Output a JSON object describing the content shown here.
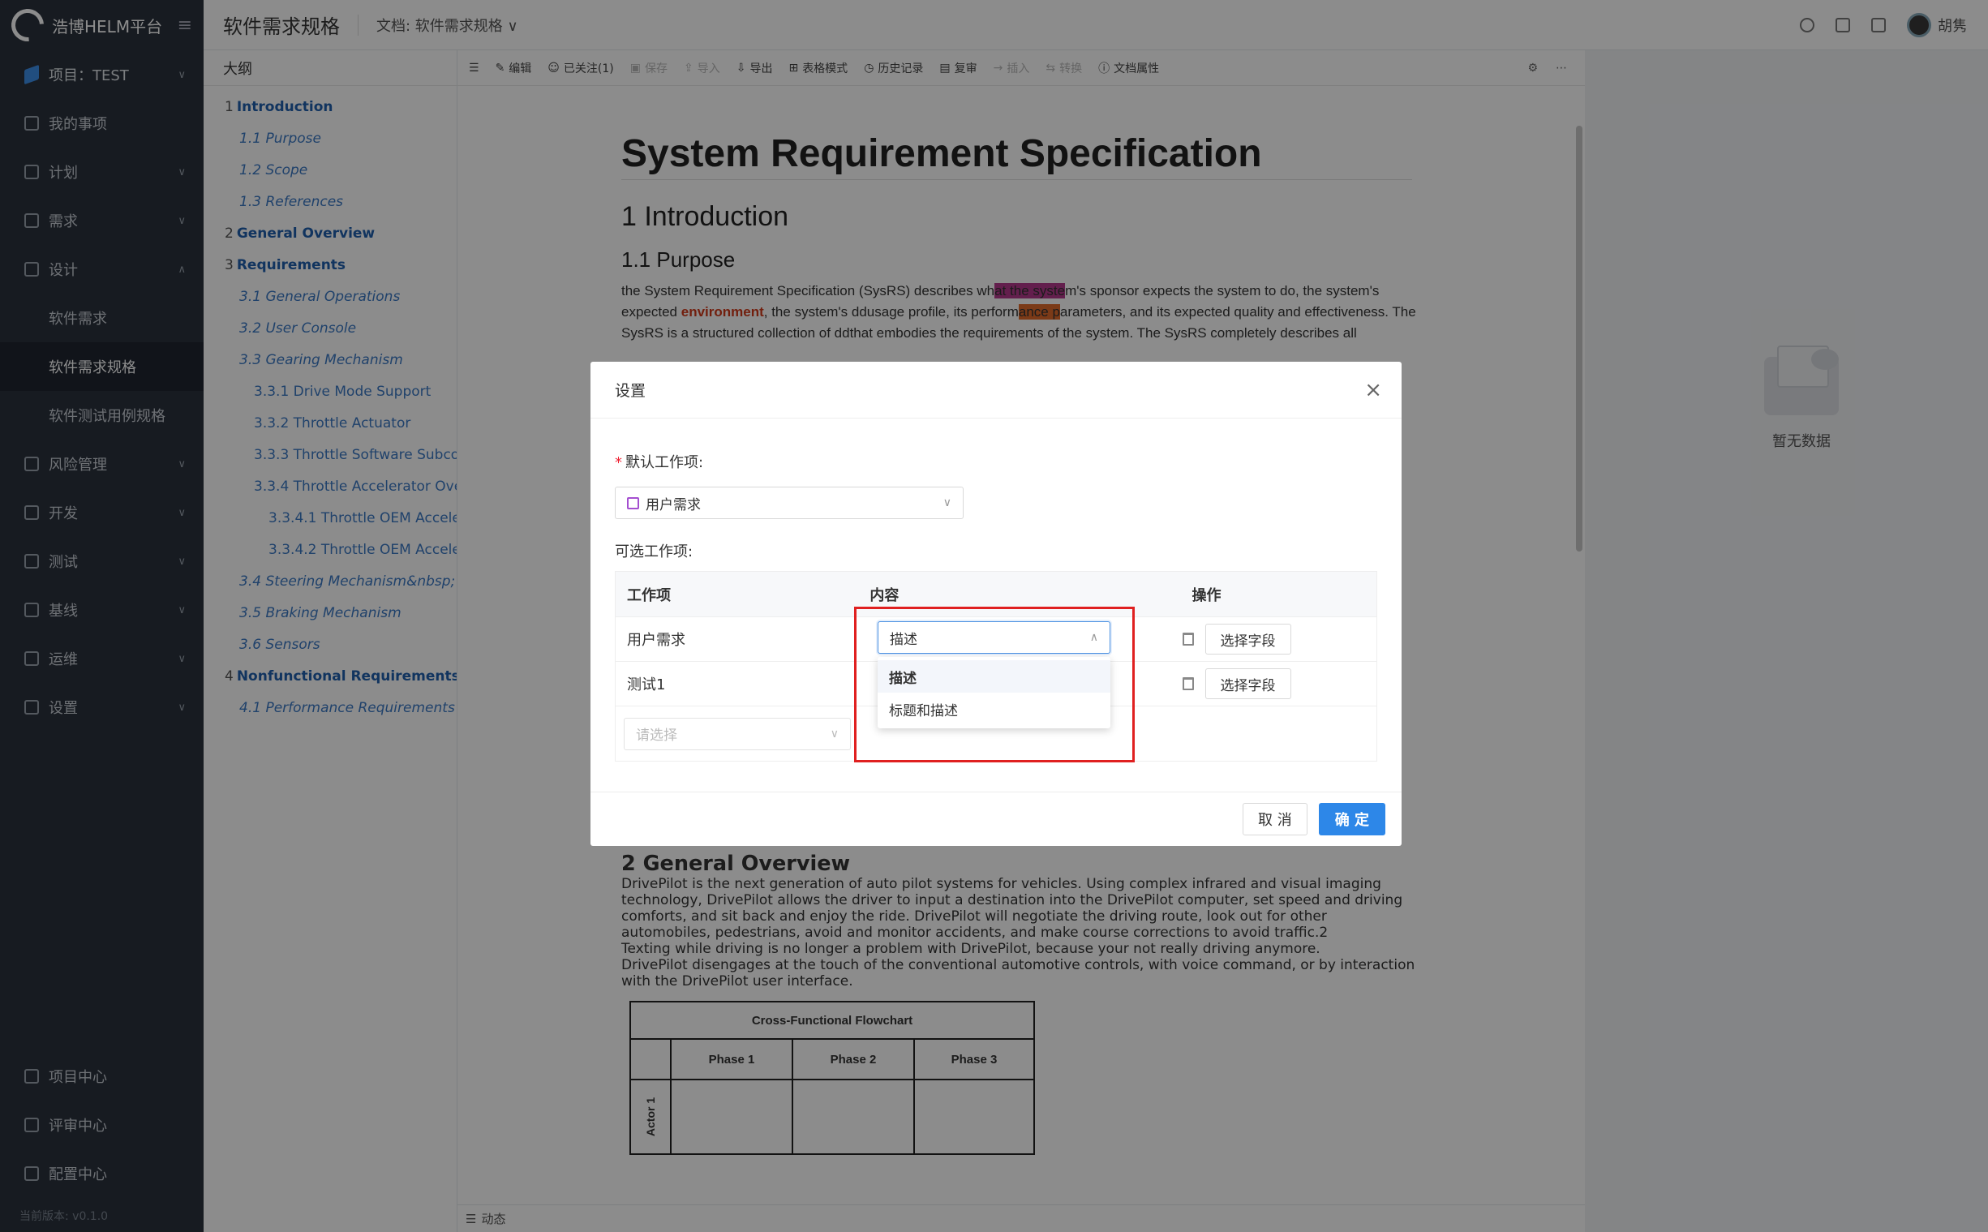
{
  "app": {
    "logo_text": "浩博HELM平台",
    "version": "当前版本: v0.1.0"
  },
  "sidebar": {
    "project": "项目：TEST",
    "items": [
      {
        "label": "我的事项",
        "chevron": false
      },
      {
        "label": "计划",
        "chevron": true
      },
      {
        "label": "需求",
        "chevron": true
      },
      {
        "label": "设计",
        "chevron": true,
        "expanded": true
      },
      {
        "label": "软件需求",
        "sub": true
      },
      {
        "label": "软件需求规格",
        "sub": true,
        "active": true
      },
      {
        "label": "软件测试用例规格",
        "sub": true
      },
      {
        "label": "风险管理",
        "chevron": true
      },
      {
        "label": "开发",
        "chevron": true
      },
      {
        "label": "测试",
        "chevron": true
      },
      {
        "label": "基线",
        "chevron": true
      },
      {
        "label": "运维",
        "chevron": true
      },
      {
        "label": "设置",
        "chevron": true
      }
    ],
    "bottom_items": [
      "项目中心",
      "评审中心",
      "配置中心"
    ]
  },
  "topbar": {
    "title": "软件需求规格",
    "doc_label": "文档: 软件需求规格",
    "user": "胡隽"
  },
  "outline": {
    "header": "大纲",
    "items": [
      {
        "num": "1",
        "text": "Introduction",
        "level": 1
      },
      {
        "text": "1.1 Purpose",
        "level": 2
      },
      {
        "text": "1.2 Scope",
        "level": 2
      },
      {
        "text": "1.3 References",
        "level": 2
      },
      {
        "num": "2",
        "text": "General Overview",
        "level": 1
      },
      {
        "num": "3",
        "text": "Requirements",
        "level": 1
      },
      {
        "text": "3.1 General Operations",
        "level": 2
      },
      {
        "text": "3.2 User Console",
        "level": 2
      },
      {
        "text": "3.3 Gearing Mechanism",
        "level": 2
      },
      {
        "text": "3.3.1 Drive Mode Support",
        "level": 3
      },
      {
        "text": "3.3.2 Throttle Actuator",
        "level": 3
      },
      {
        "text": "3.3.3 Throttle Software Subcon...",
        "level": 3
      },
      {
        "text": "3.3.4 Throttle Accelerator Over...",
        "level": 3
      },
      {
        "text": "3.3.4.1 Throttle OEM Acceler...",
        "level": 4
      },
      {
        "text": "3.3.4.2 Throttle OEM Acceler...",
        "level": 4
      },
      {
        "text": "3.4 Steering Mechanism&nbsp;",
        "level": 2
      },
      {
        "text": "3.5 Braking Mechanism",
        "level": 2
      },
      {
        "text": "3.6 Sensors",
        "level": 2
      },
      {
        "num": "4",
        "text": "Nonfunctional Requirements",
        "level": 1
      },
      {
        "text": "4.1 Performance Requirements",
        "level": 2
      }
    ]
  },
  "toolbar": {
    "items": [
      {
        "label": "编辑",
        "disabled": false
      },
      {
        "label": "已关注(1)",
        "disabled": false
      },
      {
        "label": "保存",
        "disabled": true
      },
      {
        "label": "导入",
        "disabled": true
      },
      {
        "label": "导出",
        "disabled": false
      },
      {
        "label": "表格模式",
        "disabled": false
      },
      {
        "label": "历史记录",
        "disabled": false
      },
      {
        "label": "复审",
        "disabled": false
      },
      {
        "label": "插入",
        "disabled": true
      },
      {
        "label": "转换",
        "disabled": true
      },
      {
        "label": "文档属性",
        "disabled": false
      }
    ]
  },
  "document": {
    "title": "System Requirement Specification",
    "h_intro": "1 Introduction",
    "h_purpose": "1.1 Purpose",
    "p1_a": "the System Requirement Specification (SysRS) describes wh",
    "p1_hl1": "at the syste",
    "p1_b": "m's sponsor expects the system to do, the system's expected ",
    "p1_env": "environment",
    "p1_c": ", the system's ddusage profile, its perform",
    "p1_hl2": "ance p",
    "p1_d": "arameters, and its expected quality and effectiveness. The SysRS is a structured collection of ddthat embodies the requirements of the system. The SysRS completely describes all",
    "h_overview": "2 General Overview",
    "p2": "DrivePilot is the next generation of auto pilot systems for vehicles. Using complex infrared and visual imaging technology, DrivePilot allows the driver to input a destination into the DrivePilot computer, set speed and driving comforts, and sit back and enjoy the ride. DrivePilot will negotiate the driving route, look out for other automobiles, pedestrians, avoid and monitor accidents, and make course corrections to avoid traffic.2",
    "p3": "Texting while driving is no longer a problem with DrivePilot, because your not really driving anymore.",
    "p4": "DrivePilot disengages at the touch of the conventional automotive controls, with voice command, or by interaction with the DrivePilot user interface.",
    "flowchart": {
      "title": "Cross-Functional Flowchart",
      "phases": [
        "Phase 1",
        "Phase 2",
        "Phase 3"
      ],
      "actor": "Actor 1"
    }
  },
  "right_panel": {
    "empty_text": "暂无数据"
  },
  "statusbar": {
    "label": "动态"
  },
  "modal": {
    "title": "设置",
    "default_label": "默认工作项:",
    "default_value": "用户需求",
    "optional_label": "可选工作项:",
    "columns": [
      "工作项",
      "内容",
      "操作"
    ],
    "rows": [
      {
        "item": "用户需求",
        "content": "描述",
        "action": "选择字段"
      },
      {
        "item": "测试1",
        "content": "",
        "action": "选择字段"
      }
    ],
    "add_placeholder": "请选择",
    "dropdown_options": [
      "描述",
      "标题和描述"
    ],
    "cancel": "取 消",
    "ok": "确 定"
  }
}
